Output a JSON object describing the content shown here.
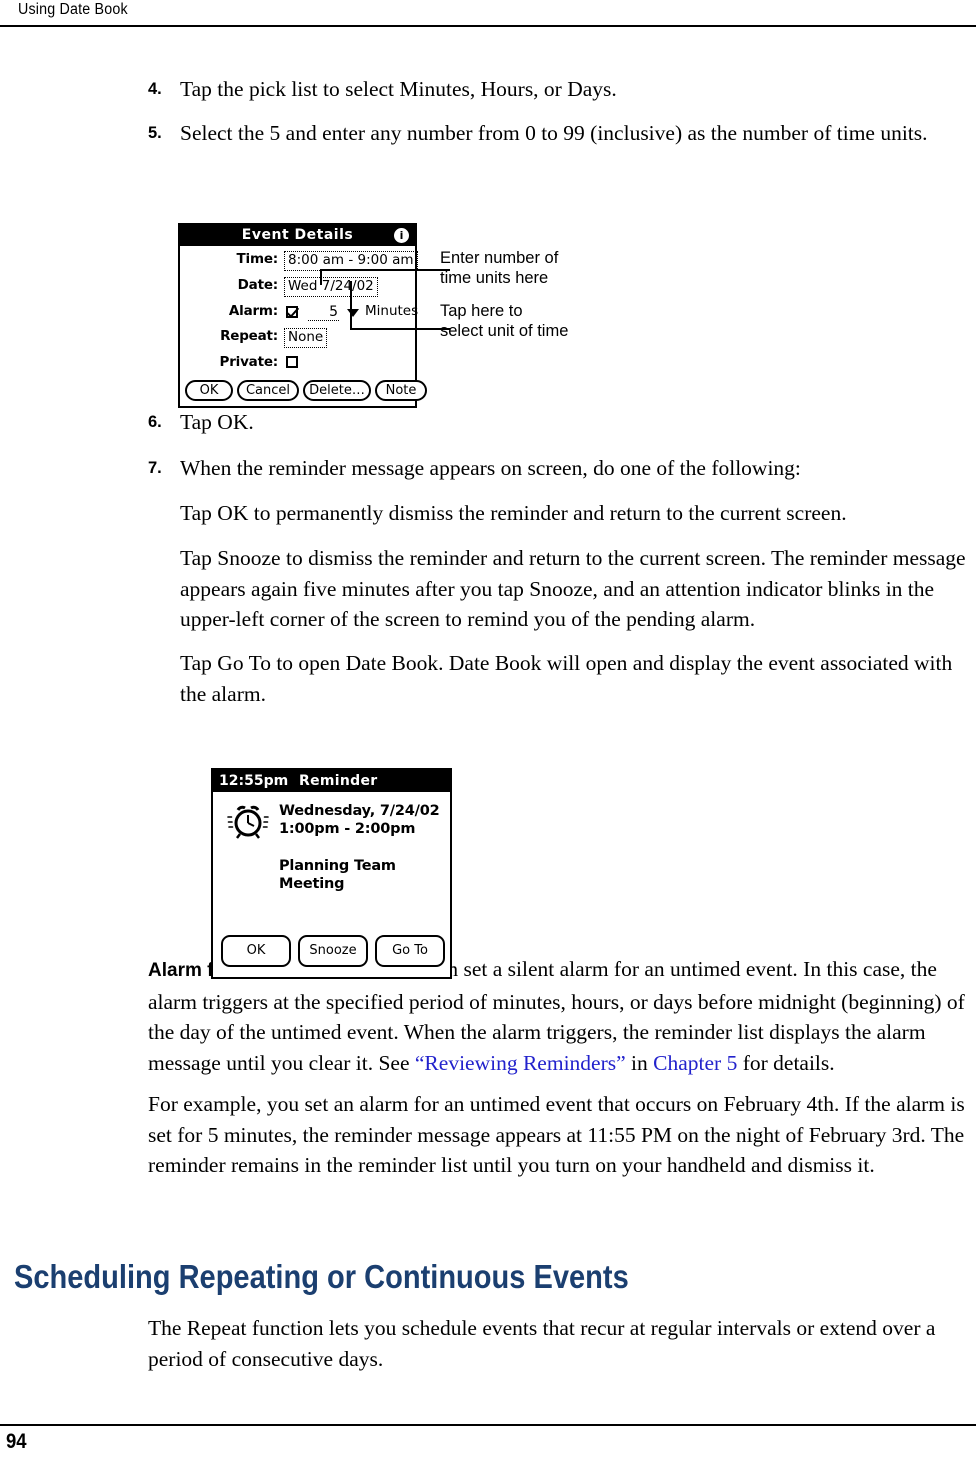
{
  "header": {
    "running_head": "Using Date Book"
  },
  "footer": {
    "page_number": "94"
  },
  "steps": [
    {
      "num": "4.",
      "text": "Tap the pick list to select Minutes, Hours, or Days."
    },
    {
      "num": "5.",
      "text": "Select the 5 and enter any number from 0 to 99 (inclusive) as the number of time units."
    },
    {
      "num": "6.",
      "text": "Tap OK."
    },
    {
      "num": "7.",
      "text": "When the reminder message appears on screen, do one of the following:"
    }
  ],
  "paragraphs": {
    "tap_ok": "Tap OK to permanently dismiss the reminder and return to the current screen.",
    "tap_snooze": "Tap Snooze to dismiss the reminder and return to the current screen. The reminder message appears again five minutes after you tap Snooze, and an attention indicator blinks in the upper-left corner of the screen to remind you of the pending alarm.",
    "tap_goto": "Tap Go To to open Date Book. Date Book will open and display the event associated with the alarm.",
    "untimed_lead": "Alarm for untimed events:",
    "untimed_part1": " You can set a silent alarm for an untimed event. In this case, the alarm triggers at the specified period of minutes, hours, or days before midnight (beginning) of the day of the untimed event. When the alarm triggers, the reminder list displays the alarm message until you clear it. See ",
    "untimed_link1": "“Reviewing Reminders”",
    "untimed_part2": " in ",
    "untimed_link2": "Chapter 5",
    "untimed_part3": " for details.",
    "example": "For example, you set an alarm for an untimed event that occurs on February 4th. If the alarm is set for 5 minutes, the reminder message appears at 11:55 PM on the night of February 3rd. The reminder remains in the reminder list until you turn on your handheld and dismiss it.",
    "repeat_intro": "The Repeat function lets you schedule events that recur at regular intervals or extend over a period of consecutive days."
  },
  "section": {
    "heading": "Scheduling Repeating or Continuous Events",
    "heading_color": "#1b3f70"
  },
  "event_details_dialog": {
    "title": "Event Details",
    "info_icon_glyph": "i",
    "rows": {
      "time_label": "Time:",
      "time_value": "8:00 am - 9:00 am",
      "date_label": "Date:",
      "date_value": "Wed 7/24/02",
      "alarm_label": "Alarm:",
      "alarm_checked": true,
      "alarm_number": "5",
      "alarm_unit": "Minutes",
      "repeat_label": "Repeat:",
      "repeat_value": "None",
      "private_label": "Private:",
      "private_checked": false
    },
    "buttons": [
      {
        "label": "OK"
      },
      {
        "label": "Cancel"
      },
      {
        "label": "Delete…"
      },
      {
        "label": "Note"
      }
    ]
  },
  "callouts": [
    {
      "text": "Enter number of\ntime units here"
    },
    {
      "text": "Tap here to\nselect unit of time"
    }
  ],
  "reminder_dialog": {
    "time": "12:55pm",
    "title": "Reminder",
    "date": "Wednesday, 7/24/02",
    "hours": "1:00pm - 2:00pm",
    "subject": "Planning Team\nMeeting",
    "icon": "alarm-clock-icon",
    "buttons": [
      {
        "label": "OK"
      },
      {
        "label": "Snooze"
      },
      {
        "label": "Go To"
      }
    ]
  }
}
